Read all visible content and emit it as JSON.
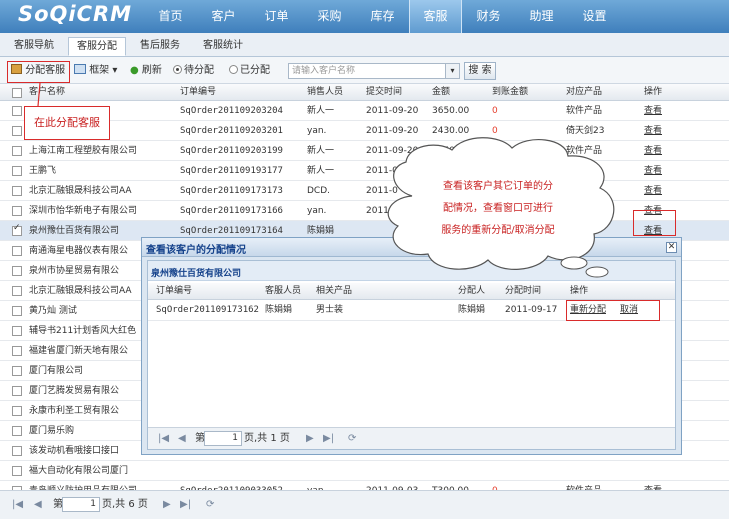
{
  "app": {
    "logo": "SoQiCRM"
  },
  "topnav": [
    "首页",
    "客户",
    "订单",
    "采购",
    "库存",
    "客服",
    "财务",
    "助理",
    "设置"
  ],
  "subtabs": [
    "客服导航",
    "客服分配",
    "售后服务",
    "客服统计"
  ],
  "toolbar": {
    "assign": "分配客服",
    "frame": "框架",
    "refresh": "刷新",
    "pending": "待分配",
    "assigned": "已分配",
    "search_placeholder": "请输入客户名称",
    "search": "搜 索"
  },
  "table": {
    "headers": [
      "客户名称",
      "订单编号",
      "销售人员",
      "提交时间",
      "金额",
      "到账金额",
      "对应产品",
      "操作"
    ],
    "rows": [
      {
        "customer": "",
        "order": "SqOrder201109203204",
        "sales": "新人一",
        "date": "2011-09-20",
        "amount": "3650.00",
        "received": "0",
        "product": "软件产品",
        "action": "查看"
      },
      {
        "customer": "",
        "order": "SqOrder201109203201",
        "sales": "yan.",
        "date": "2011-09-20",
        "amount": "2430.00",
        "received": "0",
        "product": "倚天剑23",
        "action": "查看"
      },
      {
        "customer": "上海江南工程塑胶有限公司",
        "order": "SqOrder201109203199",
        "sales": "新人一",
        "date": "2011-09-20",
        "amount": "3650.00",
        "received": "0",
        "product": "软件产品",
        "action": "查看"
      },
      {
        "customer": "王鹏飞",
        "order": "SqOrder201109193177",
        "sales": "新人一",
        "date": "2011-09-19",
        "amount": "266.00",
        "received": "",
        "product": "",
        "action": "查看"
      },
      {
        "customer": "北京汇融银晟科技公司AA",
        "order": "SqOrder201109173173",
        "sales": "DCD.",
        "date": "2011-0",
        "amount": "",
        "received": "",
        "product": "",
        "action": "查看"
      },
      {
        "customer": "深圳市怡华新电子有限公司",
        "order": "SqOrder201109173166",
        "sales": "yan.",
        "date": "2011",
        "amount": "",
        "received": "",
        "product": "",
        "action": "查看"
      },
      {
        "customer": "泉州豫仕百货有限公司",
        "order": "SqOrder201109173164",
        "sales": "陈娟娟",
        "date": "",
        "amount": "",
        "received": "",
        "product": "",
        "action": "查看"
      },
      {
        "customer": "南通海星电器仪表有限公",
        "order": "",
        "sales": "",
        "date": "",
        "amount": "",
        "received": "",
        "product": "",
        "action": ""
      },
      {
        "customer": "泉州市协星贸易有限公",
        "order": "",
        "sales": "",
        "date": "",
        "amount": "",
        "received": "",
        "product": "",
        "action": ""
      },
      {
        "customer": "北京汇融银晟科技公司AA",
        "order": "",
        "sales": "",
        "date": "",
        "amount": "",
        "received": "",
        "product": "",
        "action": ""
      },
      {
        "customer": "黄乃灿 测试",
        "order": "",
        "sales": "",
        "date": "",
        "amount": "",
        "received": "",
        "product": "",
        "action": ""
      },
      {
        "customer": "辅导书211计划香风大红色",
        "order": "",
        "sales": "",
        "date": "",
        "amount": "",
        "received": "",
        "product": "",
        "action": ""
      },
      {
        "customer": "福建省厦门新天地有限公",
        "order": "",
        "sales": "",
        "date": "",
        "amount": "",
        "received": "",
        "product": "",
        "action": ""
      },
      {
        "customer": "厦门有限公司",
        "order": "",
        "sales": "",
        "date": "",
        "amount": "",
        "received": "",
        "product": "",
        "action": ""
      },
      {
        "customer": "厦门艺腾发贸易有限公",
        "order": "",
        "sales": "",
        "date": "",
        "amount": "",
        "received": "",
        "product": "",
        "action": ""
      },
      {
        "customer": "永康市利圣工贸有限公",
        "order": "",
        "sales": "",
        "date": "",
        "amount": "",
        "received": "",
        "product": "",
        "action": ""
      },
      {
        "customer": "厦门易乐购",
        "order": "",
        "sales": "",
        "date": "",
        "amount": "",
        "received": "",
        "product": "",
        "action": ""
      },
      {
        "customer": "该发动机看哦接口接口",
        "order": "",
        "sales": "",
        "date": "",
        "amount": "",
        "received": "",
        "product": "",
        "action": ""
      },
      {
        "customer": "福大自动化有限公司厦门",
        "order": "",
        "sales": "",
        "date": "",
        "amount": "",
        "received": "",
        "product": "",
        "action": ""
      },
      {
        "customer": "青岛顺义防护用品有限公司",
        "order": "SqOrder201109033052",
        "sales": "yan.",
        "date": "2011-09-03",
        "amount": "T300.00",
        "received": "0",
        "product": "软件产品",
        "action": "查看"
      }
    ]
  },
  "pager": {
    "first": "|◀",
    "prev": "◀",
    "page_label": "第",
    "page_value": "1",
    "page_of": "页,共 6 页",
    "next": "▶",
    "last": "▶|",
    "refresh": "⟳"
  },
  "callouts": {
    "assign_tip": "在此分配客服",
    "cloud_lines": [
      "查看该客户其它订单的分",
      "配情况，查看窗口可进行",
      "服务的重新分配/取消分配"
    ]
  },
  "modal": {
    "title": "查看该客户的分配情况",
    "customer": "泉州豫仕百货有限公司",
    "headers": [
      "订单编号",
      "客服人员",
      "相关产品",
      "分配人",
      "分配时间",
      "操作"
    ],
    "rows": [
      {
        "order": "SqOrder201109173162",
        "staff": "陈娟娟",
        "product": "男士装",
        "assigner": "陈娟娟",
        "time": "2011-09-17",
        "reassign": "重新分配",
        "cancel": "取消"
      }
    ],
    "pager": {
      "first": "|◀",
      "prev": "◀",
      "page_label": "第",
      "page_value": "1",
      "page_of": "页,共 1 页",
      "next": "▶",
      "last": "▶|",
      "refresh": "⟳"
    }
  },
  "colors": {
    "header_blue": "#3f7fbc",
    "highlight_red": "#d92b2b",
    "selected_row": "#dde7f3"
  },
  "icons": [
    "assign-icon",
    "frame-icon",
    "refresh-icon",
    "close-icon"
  ]
}
